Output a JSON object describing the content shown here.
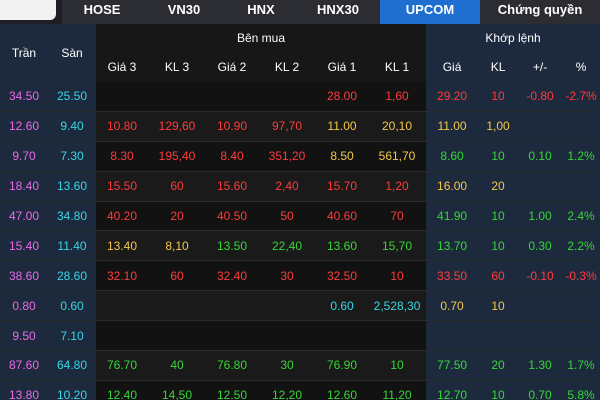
{
  "tabs": [
    {
      "label": "HOSE",
      "active": false
    },
    {
      "label": "VN30",
      "active": false
    },
    {
      "label": "HNX",
      "active": false
    },
    {
      "label": "HNX30",
      "active": false
    },
    {
      "label": "UPCOM",
      "active": true
    },
    {
      "label": "Chứng quyền",
      "active": false
    }
  ],
  "headers": {
    "tran": "Trần",
    "san": "Sàn",
    "ben_mua": "Bên mua",
    "khop_lenh": "Khớp lệnh",
    "gia3": "Giá 3",
    "kl3": "KL 3",
    "gia2": "Giá 2",
    "kl2": "KL 2",
    "gia1": "Giá 1",
    "kl1": "KL 1",
    "gia": "Giá",
    "kl": "KL",
    "change": "+/-",
    "pct": "%"
  },
  "colors": {
    "up": "#37d637",
    "down": "#ff3b3b",
    "ref": "#f2c84b",
    "ceiling": "#e86be8",
    "floor": "#37d6e6",
    "active_tab": "#1e6fd0"
  },
  "rows": [
    {
      "tran": "34.50",
      "san": "25.50",
      "gia3": "",
      "kl3": "",
      "gia2": "",
      "kl2": "",
      "gia1": "28.00",
      "kl1": "1,60",
      "gia": "29.20",
      "kl": "10",
      "chg": "-0.80",
      "pct": "-2.7%",
      "c": {
        "g3": "",
        "g2": "",
        "g1": "r",
        "gm": "r"
      }
    },
    {
      "tran": "12.60",
      "san": "9.40",
      "gia3": "10.80",
      "kl3": "129,60",
      "gia2": "10.90",
      "kl2": "97,70",
      "gia1": "11.00",
      "kl1": "20,10",
      "gia": "11.00",
      "kl": "1,00",
      "chg": "",
      "pct": "",
      "c": {
        "g3": "r",
        "g2": "r",
        "g1": "y",
        "gm": "y"
      }
    },
    {
      "tran": "9.70",
      "san": "7.30",
      "gia3": "8.30",
      "kl3": "195,40",
      "gia2": "8.40",
      "kl2": "351,20",
      "gia1": "8.50",
      "kl1": "561,70",
      "gia": "8.60",
      "kl": "10",
      "chg": "0.10",
      "pct": "1.2%",
      "c": {
        "g3": "r",
        "g2": "r",
        "g1": "y",
        "gm": "g"
      }
    },
    {
      "tran": "18.40",
      "san": "13.60",
      "gia3": "15.50",
      "kl3": "60",
      "gia2": "15.60",
      "kl2": "2,40",
      "gia1": "15.70",
      "kl1": "1,20",
      "gia": "16.00",
      "kl": "20",
      "chg": "",
      "pct": "",
      "c": {
        "g3": "r",
        "g2": "r",
        "g1": "r",
        "gm": "y"
      }
    },
    {
      "tran": "47.00",
      "san": "34.80",
      "gia3": "40.20",
      "kl3": "20",
      "gia2": "40.50",
      "kl2": "50",
      "gia1": "40.60",
      "kl1": "70",
      "gia": "41.90",
      "kl": "10",
      "chg": "1.00",
      "pct": "2.4%",
      "c": {
        "g3": "r",
        "g2": "r",
        "g1": "r",
        "gm": "g"
      }
    },
    {
      "tran": "15.40",
      "san": "11.40",
      "gia3": "13.40",
      "kl3": "8,10",
      "gia2": "13.50",
      "kl2": "22,40",
      "gia1": "13.60",
      "kl1": "15,70",
      "gia": "13.70",
      "kl": "10",
      "chg": "0.30",
      "pct": "2.2%",
      "c": {
        "g3": "y",
        "g2": "g",
        "g1": "g",
        "gm": "g"
      }
    },
    {
      "tran": "38.60",
      "san": "28.60",
      "gia3": "32.10",
      "kl3": "60",
      "gia2": "32.40",
      "kl2": "30",
      "gia1": "32.50",
      "kl1": "10",
      "gia": "33.50",
      "kl": "60",
      "chg": "-0.10",
      "pct": "-0.3%",
      "c": {
        "g3": "r",
        "g2": "r",
        "g1": "r",
        "gm": "r"
      }
    },
    {
      "tran": "0.80",
      "san": "0.60",
      "gia3": "",
      "kl3": "",
      "gia2": "",
      "kl2": "",
      "gia1": "0.60",
      "kl1": "2,528,30",
      "gia": "0.70",
      "kl": "10",
      "chg": "",
      "pct": "",
      "c": {
        "g3": "",
        "g2": "",
        "g1": "c",
        "gm": "y"
      }
    },
    {
      "tran": "9.50",
      "san": "7.10",
      "gia3": "",
      "kl3": "",
      "gia2": "",
      "kl2": "",
      "gia1": "",
      "kl1": "",
      "gia": "",
      "kl": "",
      "chg": "",
      "pct": "",
      "c": {
        "g3": "",
        "g2": "",
        "g1": "",
        "gm": ""
      }
    },
    {
      "tran": "87.60",
      "san": "64.80",
      "gia3": "76.70",
      "kl3": "40",
      "gia2": "76.80",
      "kl2": "30",
      "gia1": "76.90",
      "kl1": "10",
      "gia": "77.50",
      "kl": "20",
      "chg": "1.30",
      "pct": "1.7%",
      "c": {
        "g3": "g",
        "g2": "g",
        "g1": "g",
        "gm": "g"
      }
    },
    {
      "tran": "13.80",
      "san": "10.20",
      "gia3": "12.40",
      "kl3": "14,50",
      "gia2": "12.50",
      "kl2": "12,20",
      "gia1": "12.60",
      "kl1": "11,20",
      "gia": "12.70",
      "kl": "10",
      "chg": "0.70",
      "pct": "5.8%",
      "c": {
        "g3": "g",
        "g2": "g",
        "g1": "g",
        "gm": "g"
      }
    }
  ]
}
